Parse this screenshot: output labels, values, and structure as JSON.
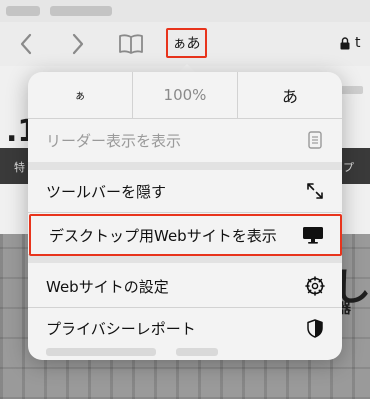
{
  "toolbar": {
    "text_size_button_label": "ぁあ",
    "url_partial": "t"
  },
  "popover": {
    "zoom_decrease_label": "ぁ",
    "zoom_level": "100%",
    "zoom_increase_label": "あ",
    "items": [
      {
        "label": "リーダー表示を表示",
        "icon": "reader-view-icon",
        "enabled": false
      },
      {
        "label": "ツールバーを隠す",
        "icon": "expand-arrows-icon",
        "enabled": true
      },
      {
        "label": "デスクトップ用Webサイトを表示",
        "icon": "desktop-monitor-icon",
        "enabled": true,
        "highlighted": true
      },
      {
        "label": "Webサイトの設定",
        "icon": "gear-icon",
        "enabled": true
      },
      {
        "label": "プライバシーレポート",
        "icon": "privacy-shield-icon",
        "enabled": true
      }
    ]
  },
  "webpage": {
    "band_left_char": "特",
    "band_right_text": "プ",
    "photo_large_char": "し",
    "photo_small_text": "器"
  },
  "colors": {
    "highlight_border": "#e8341c",
    "popover_bg": "#f3f3f3"
  }
}
